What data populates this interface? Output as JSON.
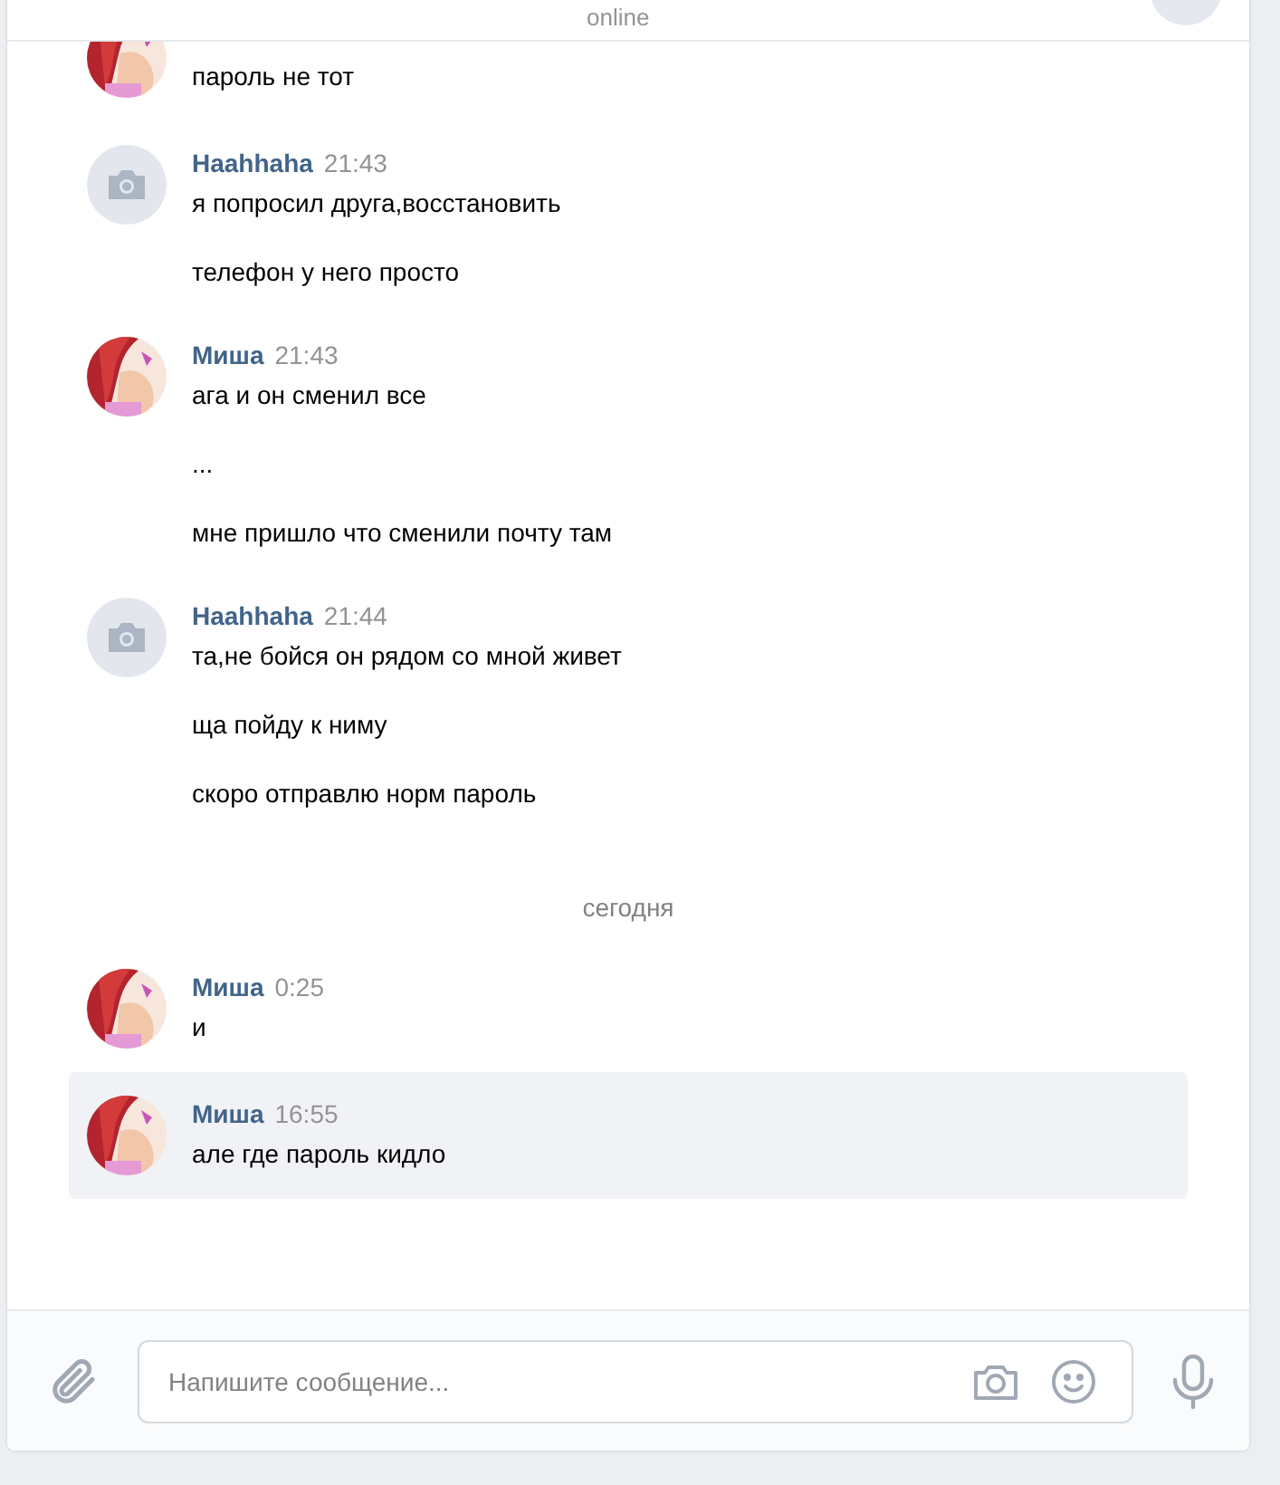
{
  "header": {
    "status": "online"
  },
  "messages": [
    {
      "avatar": {
        "kind": "picture"
      },
      "selected": false,
      "lines": [
        "пароль не тот"
      ]
    },
    {
      "author": "Haahhaha",
      "time": "21:43",
      "avatar": {
        "kind": "placeholder"
      },
      "selected": false,
      "lines": [
        "я попросил друга,восстановить",
        "телефон у него просто"
      ]
    },
    {
      "author": "Миша",
      "time": "21:43",
      "avatar": {
        "kind": "picture"
      },
      "selected": false,
      "lines": [
        "ага и он сменил все",
        "...",
        "мне пришло что сменили почту там"
      ]
    },
    {
      "author": "Haahhaha",
      "time": "21:44",
      "avatar": {
        "kind": "placeholder"
      },
      "selected": false,
      "lines": [
        "та,не бойся он рядом со мной живет",
        "ща пойду к ниму",
        "скоро отправлю норм пароль"
      ]
    },
    {
      "kind": "date",
      "text": "сегодня"
    },
    {
      "author": "Миша",
      "time": "0:25",
      "avatar": {
        "kind": "picture"
      },
      "selected": false,
      "lines": [
        "и"
      ]
    },
    {
      "author": "Миша",
      "time": "16:55",
      "avatar": {
        "kind": "picture"
      },
      "selected": true,
      "lines": [
        "але где пароль кидло"
      ]
    }
  ],
  "composer": {
    "placeholder": "Напишите сообщение..."
  }
}
